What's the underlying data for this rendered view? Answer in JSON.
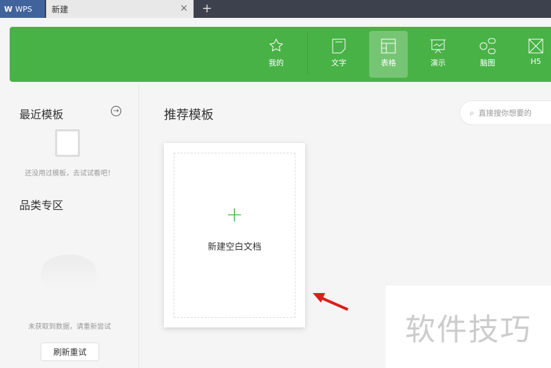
{
  "tabbar": {
    "app": "WPS",
    "tab": "新建",
    "close": "×",
    "new_tab": "+"
  },
  "nav": [
    {
      "label": "我的"
    },
    {
      "label": "文字"
    },
    {
      "label": "表格"
    },
    {
      "label": "演示"
    },
    {
      "label": "脑图"
    },
    {
      "label": "H5"
    }
  ],
  "sidebar": {
    "recent_title": "最近模板",
    "recent_empty": "还没用过模板，去试试看吧！",
    "category_title": "品类专区",
    "category_empty": "未获取到数据，请重新尝试",
    "retry": "刷新重试"
  },
  "main": {
    "title": "推荐模板",
    "search_placeholder": "直接搜你想要的",
    "new_blank": "新建空白文档"
  },
  "watermark": "软件技巧",
  "colors": {
    "brand_green": "#48b246",
    "arrow": "#d9201c"
  }
}
